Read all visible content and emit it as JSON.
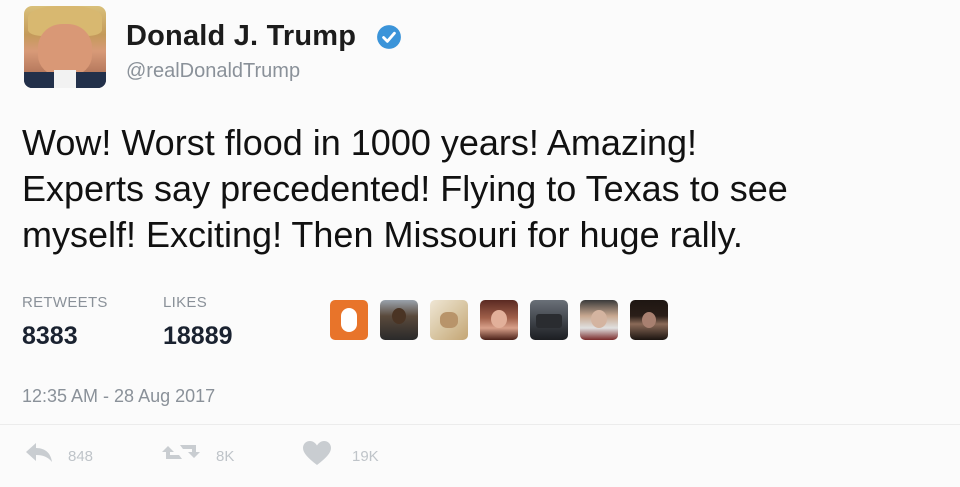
{
  "user": {
    "name": "Donald J. Trump",
    "handle": "@realDonaldTrump",
    "verified_color": "#3b94d9"
  },
  "tweet": {
    "text": "Wow! Worst flood in 1000 years! Amazing!\nExperts say precedented! Flying to Texas to see\nmyself! Exciting! Then Missouri for huge rally.",
    "timestamp": "12:35 AM - 28 Aug 2017"
  },
  "stats": {
    "retweets_label": "RETWEETS",
    "retweets_value": "8383",
    "likes_label": "LIKES",
    "likes_value": "18889"
  },
  "likers": [
    "orange-logo",
    "man-photo",
    "cat-photo",
    "woman-photo",
    "group-photo",
    "person-photo",
    "woman-dark-photo"
  ],
  "actions": {
    "reply_count": "848",
    "retweet_count": "8K",
    "like_count": "19K"
  },
  "colors": {
    "accent": "#3b94d9",
    "muted": "#8a9199",
    "action_icon": "#c9cdd1"
  }
}
